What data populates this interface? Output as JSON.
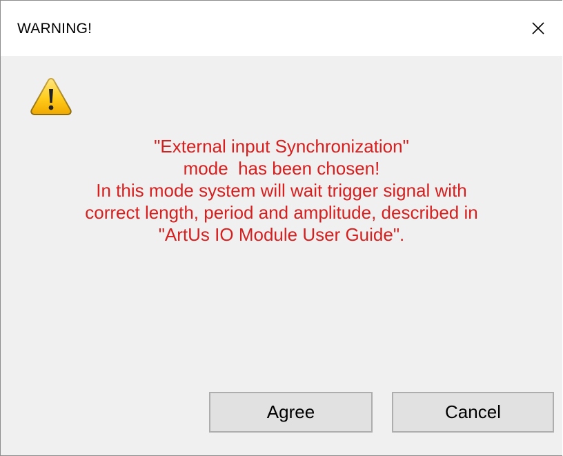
{
  "window": {
    "title": "WARNING!",
    "close_icon": "close-icon"
  },
  "dialog": {
    "icon": "warning-icon",
    "message_lines": [
      "\"External input Synchronization\"",
      "mode  has been chosen!",
      "In this mode system will wait trigger signal with",
      "correct length, period and amplitude, described in",
      "\"ArtUs IO Module User Guide\"."
    ],
    "message_color": "#d61f1f"
  },
  "buttons": {
    "agree_label": "Agree",
    "cancel_label": "Cancel"
  }
}
